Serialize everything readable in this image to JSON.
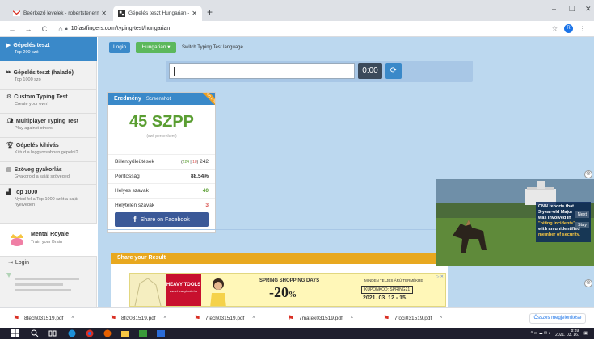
{
  "browser": {
    "tabs": [
      {
        "label": "Beérkező levelek - robertstenerm...",
        "active": false
      },
      {
        "label": "Gépelés teszt Hungarian - 10fas...",
        "active": true
      }
    ],
    "new_tab_symbol": "+",
    "url": "10fastfingers.com/typing-test/hungarian",
    "profile_initial": "R",
    "window_controls": [
      "–",
      "❐",
      "✕"
    ]
  },
  "sidebar": {
    "items": [
      {
        "title": "Gépelés teszt",
        "subtitle": "Top 200 szó",
        "icon": "play-icon",
        "active": true
      },
      {
        "title": "Gépelés teszt (haladó)",
        "subtitle": "Top 1000 szó",
        "icon": "fast-forward-icon",
        "active": false
      },
      {
        "title": "Custom Typing Test",
        "subtitle": "Create your own!",
        "icon": "settings-icon",
        "active": false
      },
      {
        "title": "Multiplayer Typing Test",
        "subtitle": "Play against others",
        "icon": "users-icon",
        "active": false
      },
      {
        "title": "Gépelés kihívás",
        "subtitle": "Ki tud a leggyorsabban gépelni?",
        "icon": "trophy-icon",
        "active": false
      },
      {
        "title": "Szöveg gyakorlás",
        "subtitle": "Gyakorold a saját szöveged",
        "icon": "document-icon",
        "active": false
      },
      {
        "title": "Top 1000",
        "subtitle": "Nyisd fel a Top 1000 szót a saját nyelveden",
        "icon": "bar-chart-icon",
        "active": false
      }
    ],
    "mental_royale": {
      "title": "Mental Royale",
      "subtitle": "Train your Brain"
    },
    "login_label": "Login"
  },
  "main": {
    "login_button": "Login",
    "language_button": "Hungarian",
    "language_caret": "▾",
    "switch_text": "Switch Typing Test language",
    "timer": "0:00",
    "refresh_symbol": "⟳"
  },
  "result": {
    "header_title": "Eredmény",
    "header_link": "Screenshot",
    "ribbon": "Top 1 %",
    "wpm": "45 SZPP",
    "wpm_sub": "(szó percenként)",
    "rows": [
      {
        "label": "Billentyűleütések",
        "detail_green": "224",
        "detail_sep": " | ",
        "detail_red": "18",
        "value": "242"
      },
      {
        "label": "Pontosság",
        "value": "88.54%"
      },
      {
        "label": "Helyes szavak",
        "value": "40"
      },
      {
        "label": "Helytelen szavak",
        "value": "3"
      }
    ],
    "facebook_button": "Share on Facebook",
    "facebook_letter": "f"
  },
  "share_bar": "Share your Result",
  "video_ad": {
    "line1": "CNN reports that",
    "line2": "3-year-old Major",
    "line3": "was involved in",
    "line4": "\"biting incidents\"",
    "line5": "with an unidentified",
    "line6": "member of security.",
    "next_label": "Next",
    "stay_label": "Stay",
    "close_symbol": "⊗"
  },
  "banner_ad": {
    "brand": "HEAVY TOOLS",
    "brand_sub": "www.heavytools.hu",
    "headline": "SPRING SHOPPING DAYS",
    "discount": "-20",
    "discount_suffix": "%",
    "tagline": "MINDEN TELJES ÁRÚ TERMÉKRE",
    "coupon": "KUPONKÓD: SPRING21",
    "dates": "2021. 03. 12 - 15.",
    "ad_marker": "▷ ✕",
    "close_symbol": "⊗"
  },
  "downloads": {
    "files": [
      "8tech031519.pdf",
      "8fiz031519.pdf",
      "7tech031519.pdf",
      "7matek031519.pdf",
      "7foci031519.pdf"
    ],
    "show_all": "Összes megjelenítése",
    "chevron": "^"
  },
  "taskbar": {
    "time": "8:39",
    "date": "2021. 03. 16."
  },
  "colors": {
    "primary_blue": "#3a89c9",
    "green": "#5cb85c",
    "wpm_green": "#5a9e32",
    "facebook": "#3b5998",
    "share_orange": "#e8a81f",
    "page_bg": "#bcd8ef"
  }
}
